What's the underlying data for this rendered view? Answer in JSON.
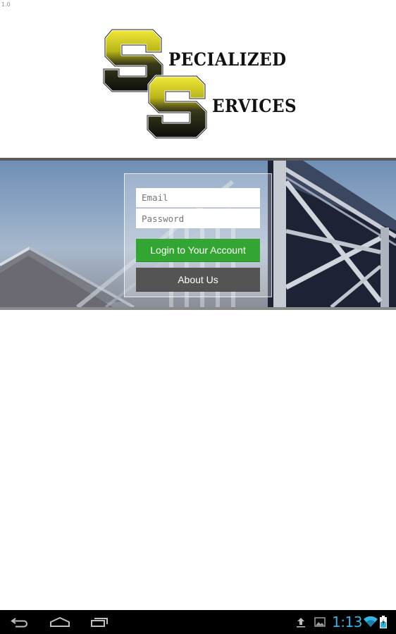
{
  "app": {
    "version": "1.0"
  },
  "logo": {
    "line1_initial": "S",
    "line1_rest": "PECIALIZED",
    "line2_initial": "S",
    "line2_rest": "ERVICES",
    "colors": {
      "gold": "#d8d21a",
      "black": "#111111"
    }
  },
  "login_form": {
    "email": {
      "value": "",
      "placeholder": "Email"
    },
    "password": {
      "value": "",
      "placeholder": "Password"
    },
    "login_button_label": "Login to Your Account",
    "about_button_label": "About Us",
    "colors": {
      "login_button": "#33a532",
      "about_button": "#545454"
    }
  },
  "system_bar": {
    "nav_buttons": [
      "back-icon",
      "home-icon",
      "recent-apps-icon"
    ],
    "status_icons": [
      "upload-icon",
      "image-notification-icon",
      "wifi-icon",
      "battery-charging-icon"
    ],
    "time": "1:13",
    "accent_color": "#33b5e5"
  }
}
